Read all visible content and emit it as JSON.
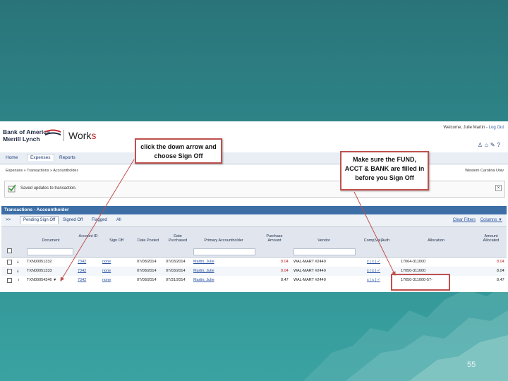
{
  "brand": {
    "line1": "Bank of America",
    "line2": "Merrill Lynch",
    "product_prefix": "Work",
    "product_suffix": "s"
  },
  "header": {
    "welcome": "Welcome, Julie Martin -",
    "logout": "Log Out",
    "icons": [
      "user-icon",
      "home-icon",
      "wrench-icon",
      "help-icon"
    ]
  },
  "nav": {
    "items": [
      "Home",
      "Expenses",
      "Reports"
    ]
  },
  "breadcrumb": {
    "text": "Expenses  »  Transactions  »  Accountholder",
    "right": "Western Carolina Univ"
  },
  "message": {
    "text": "Saved updates to transaction."
  },
  "panel": {
    "title": "Transactions - Accountholder"
  },
  "tabs": {
    "back": ">>",
    "items": [
      "Pending Sign Off",
      "Signed Off",
      "Flagged",
      "All"
    ],
    "clear_filters": "Clear Filters",
    "columns": "Columns ▼"
  },
  "table": {
    "headers": [
      "Document",
      "Account ID",
      "Sign Off",
      "Date Posted",
      "Date Purchased",
      "Primary Accountholder",
      "Purchase Amount",
      "Vendor",
      "Comp|Val|Auth",
      "Allocation",
      "Amount Allocated"
    ],
    "rows": [
      {
        "doc": "TXN00051332",
        "acct": "7342",
        "signoff": "none",
        "posted": "07/08/2014",
        "purchased": "07/03/2014",
        "holder": "Martin, Julie",
        "amount": "8.04",
        "vendor": "WAL-MART #2440",
        "cva": "x | x | ✓",
        "alloc": "17064-311000",
        "allocated": "8.04"
      },
      {
        "doc": "TXN00051333",
        "acct": "7342",
        "signoff": "none",
        "posted": "07/08/2014",
        "purchased": "07/03/2014",
        "holder": "Martin, Julie",
        "amount": "8.04",
        "vendor": "WAL-MART #2440",
        "cva": "x | x | ✓",
        "alloc": "17050-311000",
        "allocated": "8.04"
      },
      {
        "doc": "TXN00054346 ▼",
        "acct": "7342",
        "signoff": "none",
        "posted": "07/08/2014",
        "purchased": "07/31/2014",
        "holder": "Martin, Julie",
        "amount": "8.47",
        "vendor": "WAL-MART #2440",
        "cva": "x | x | ✓",
        "alloc": "17050-311000-57-",
        "allocated": "8.47"
      }
    ]
  },
  "callouts": {
    "signoff": [
      "click the down arrow and",
      "choose Sign Off"
    ],
    "fund": [
      "Make sure the FUND,",
      "ACCT & BANK are filled in",
      "before you Sign Off"
    ]
  },
  "slide": {
    "page_number": "55"
  },
  "colors": {
    "accent_red": "#c0504d",
    "nav_blue": "#3d6ea6",
    "background_teal": "#2e8a8d"
  }
}
